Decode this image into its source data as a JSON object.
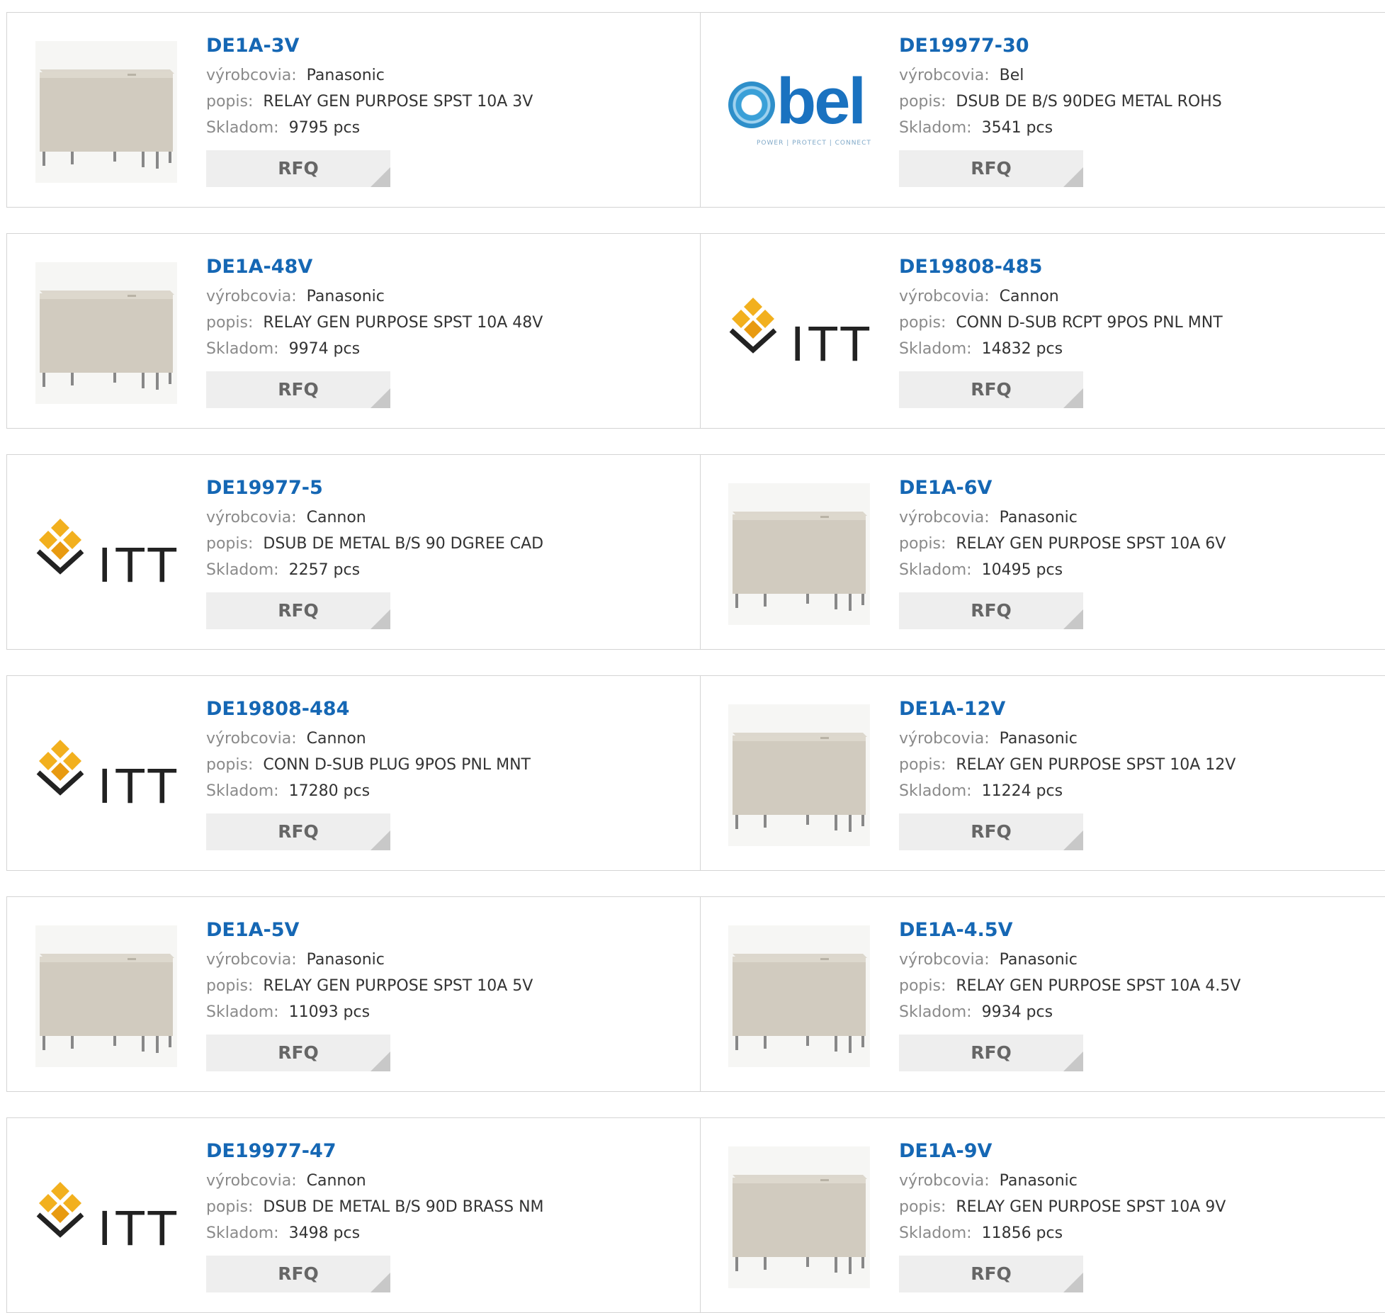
{
  "labels": {
    "manufacturer": "výrobcovia:",
    "description": "popis:",
    "stock": "Skladom:",
    "rfq": "RFQ"
  },
  "colors": {
    "part_number": "#1567b4",
    "border": "#d4d4d4",
    "rfq_bg": "#eeeeee"
  },
  "products": [
    {
      "pn": "DE1A-3V",
      "mfr": "Panasonic",
      "desc": "RELAY GEN PURPOSE SPST 10A 3V",
      "stock": "9795 pcs",
      "image": "relay"
    },
    {
      "pn": "DE19977-30",
      "mfr": "Bel",
      "desc": "DSUB DE B/S 90DEG METAL ROHS",
      "stock": "3541 pcs",
      "image": "bel-logo"
    },
    {
      "pn": "DE1A-48V",
      "mfr": "Panasonic",
      "desc": "RELAY GEN PURPOSE SPST 10A 48V",
      "stock": "9974 pcs",
      "image": "relay"
    },
    {
      "pn": "DE19808-485",
      "mfr": "Cannon",
      "desc": "CONN D-SUB RCPT 9POS PNL MNT",
      "stock": "14832 pcs",
      "image": "itt-logo"
    },
    {
      "pn": "DE19977-5",
      "mfr": "Cannon",
      "desc": "DSUB DE METAL B/S 90 DGREE CAD",
      "stock": "2257 pcs",
      "image": "itt-logo"
    },
    {
      "pn": "DE1A-6V",
      "mfr": "Panasonic",
      "desc": "RELAY GEN PURPOSE SPST 10A 6V",
      "stock": "10495 pcs",
      "image": "relay"
    },
    {
      "pn": "DE19808-484",
      "mfr": "Cannon",
      "desc": "CONN D-SUB PLUG 9POS PNL MNT",
      "stock": "17280 pcs",
      "image": "itt-logo"
    },
    {
      "pn": "DE1A-12V",
      "mfr": "Panasonic",
      "desc": "RELAY GEN PURPOSE SPST 10A 12V",
      "stock": "11224 pcs",
      "image": "relay"
    },
    {
      "pn": "DE1A-5V",
      "mfr": "Panasonic",
      "desc": "RELAY GEN PURPOSE SPST 10A 5V",
      "stock": "11093 pcs",
      "image": "relay"
    },
    {
      "pn": "DE1A-4.5V",
      "mfr": "Panasonic",
      "desc": "RELAY GEN PURPOSE SPST 10A 4.5V",
      "stock": "9934 pcs",
      "image": "relay"
    },
    {
      "pn": "DE19977-47",
      "mfr": "Cannon",
      "desc": "DSUB DE METAL B/S 90D BRASS NM",
      "stock": "3498 pcs",
      "image": "itt-logo"
    },
    {
      "pn": "DE1A-9V",
      "mfr": "Panasonic",
      "desc": "RELAY GEN PURPOSE SPST 10A 9V",
      "stock": "11856 pcs",
      "image": "relay"
    }
  ],
  "logos": {
    "bel_word": "bel",
    "bel_tag": "POWER | PROTECT | CONNECT",
    "itt_word": "ITT"
  }
}
